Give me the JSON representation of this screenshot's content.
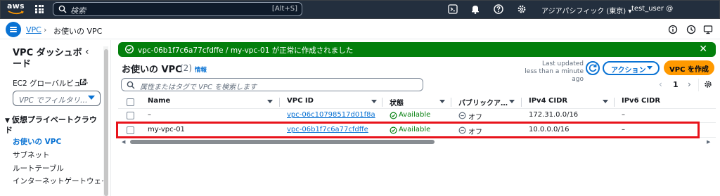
{
  "topnav": {
    "logo_text": "aws",
    "search_placeholder": "検索",
    "search_shortcut": "[Alt+S]",
    "region": "アジアパシフィック (東京) ▾",
    "user": "test_user @"
  },
  "breadcrumb": {
    "parent": "VPC",
    "separator": "›",
    "current": "お使いの VPC"
  },
  "sidebar": {
    "title": "VPC ダッシュボード",
    "ec2_link": "EC2 グローバルビュー",
    "filter_placeholder": "VPC でフィルタリ…",
    "section_title": "仮想プライベートクラウド",
    "items": [
      {
        "label": "お使いの VPC",
        "active": true
      },
      {
        "label": "サブネット",
        "active": false
      },
      {
        "label": "ルートテーブル",
        "active": false
      },
      {
        "label": "インターネットゲートウェイ",
        "active": false
      }
    ]
  },
  "flash": {
    "message": "vpc-06b1f7c6a77cfdffe / my-vpc-01 が正常に作成されました",
    "color": "#037f0c"
  },
  "table": {
    "title": "お使いの VPC",
    "count": "(2)",
    "info": "情報",
    "last_updated_line1": "Last updated",
    "last_updated_line2": "less than a minute ago",
    "actions_label": "アクション",
    "create_label": "VPC を作成",
    "search_placeholder": "属性またはタグで VPC を検索します",
    "page": "1",
    "columns": [
      "Name",
      "VPC ID",
      "状態",
      "パブリックア…",
      "IPv4 CIDR",
      "IPv6 CIDR"
    ],
    "rows": [
      {
        "name": "–",
        "vpc_id": "vpc-06c10798517d01f8a",
        "state": "Available",
        "public": "オフ",
        "ipv4": "172.31.0.0/16",
        "ipv6": "–"
      },
      {
        "name": "my-vpc-01",
        "vpc_id": "vpc-06b1f7c6a77cfdffe",
        "state": "Available",
        "public": "オフ",
        "ipv4": "10.0.0.0/16",
        "ipv6": "–"
      }
    ]
  },
  "colors": {
    "accent": "#0972d3",
    "nav_bg": "#232f3e",
    "primary_button": "#ff9900",
    "success": "#037f0c",
    "highlight": "#e8131b"
  }
}
